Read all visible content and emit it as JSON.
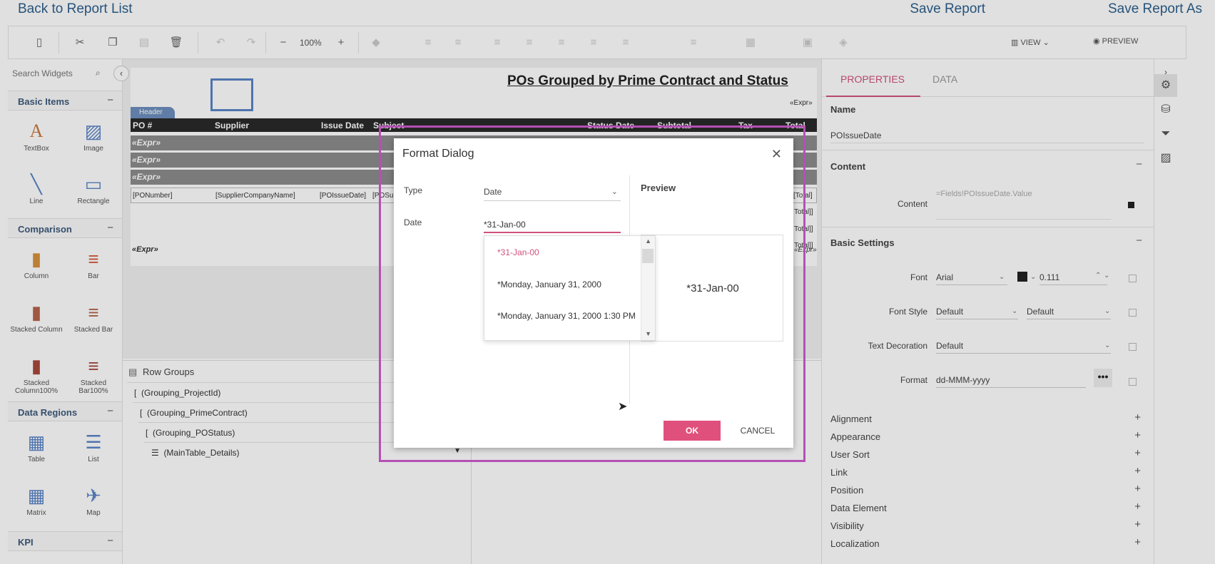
{
  "topbar": {
    "back": "Back to Report List",
    "save": "Save Report",
    "save_as": "Save Report As"
  },
  "toolbar": {
    "zoom": "100%",
    "view": "VIEW",
    "preview": "PREVIEW"
  },
  "widgets": {
    "search_placeholder": "Search Widgets",
    "sections": {
      "basic": "Basic Items",
      "comparison": "Comparison",
      "data_regions": "Data Regions",
      "kpi": "KPI"
    },
    "items": {
      "textbox": "TextBox",
      "image": "Image",
      "line": "Line",
      "rectangle": "Rectangle",
      "column": "Column",
      "bar": "Bar",
      "stacked_column": "Stacked Column",
      "stacked_bar": "Stacked Bar",
      "stacked_column100": "Stacked Column100%",
      "stacked_bar100": "Stacked Bar100%",
      "table": "Table",
      "list": "List",
      "matrix": "Matrix",
      "map": "Map"
    }
  },
  "report": {
    "title": "POs Grouped by Prime Contract and Status",
    "expr_top": "«Expr»",
    "header_tag": "Header",
    "columns": [
      "PO #",
      "Supplier",
      "Issue Date",
      "Subject",
      "Status Date",
      "Subtotal",
      "Tax",
      "Total"
    ],
    "group_rows": [
      "«Expr»",
      "«Expr»",
      "«Expr»"
    ],
    "detail": [
      "[PONumber]",
      "[SupplierCompanyName]",
      "[POIssueDate]",
      "[POSu",
      "[Total]"
    ],
    "total_rows": [
      "Total]]",
      "Total]]",
      "Total]]"
    ],
    "expr_bottom": "«Expr»",
    "expr_bottom_right": "«Expr»"
  },
  "row_groups": {
    "title": "Row Groups",
    "items": [
      "(Grouping_ProjectId)",
      "(Grouping_PrimeContract)",
      "(Grouping_POStatus)",
      "(MainTable_Details)"
    ]
  },
  "props": {
    "tabs": {
      "properties": "PROPERTIES",
      "data": "DATA"
    },
    "name_title": "Name",
    "name_value": "POIssueDate",
    "content_title": "Content",
    "content_label": "Content",
    "content_value": "=Fields!POIssueDate.Value",
    "basic_title": "Basic Settings",
    "font_label": "Font",
    "font_value": "Arial",
    "font_size": "0.111",
    "font_style_label": "Font Style",
    "font_style_value": "Default",
    "font_weight_value": "Default",
    "text_decoration_label": "Text Decoration",
    "text_decoration_value": "Default",
    "format_label": "Format",
    "format_value": "dd-MMM-yyyy",
    "collapsed": [
      "Alignment",
      "Appearance",
      "User Sort",
      "Link",
      "Position",
      "Data Element",
      "Visibility",
      "Localization"
    ]
  },
  "dialog": {
    "title": "Format Dialog",
    "type_label": "Type",
    "type_value": "Date",
    "date_label": "Date",
    "date_value": "*31-Jan-00",
    "options": [
      "*31-Jan-00",
      "*Monday, January 31, 2000",
      "*Monday, January 31, 2000 1:30 PM"
    ],
    "preview_title": "Preview",
    "preview_value": "*31-Jan-00",
    "ok": "OK",
    "cancel": "CANCEL"
  },
  "colors": {
    "accent": "#e0507d",
    "highlight": "#b550b5",
    "link": "#2c5f8d"
  }
}
